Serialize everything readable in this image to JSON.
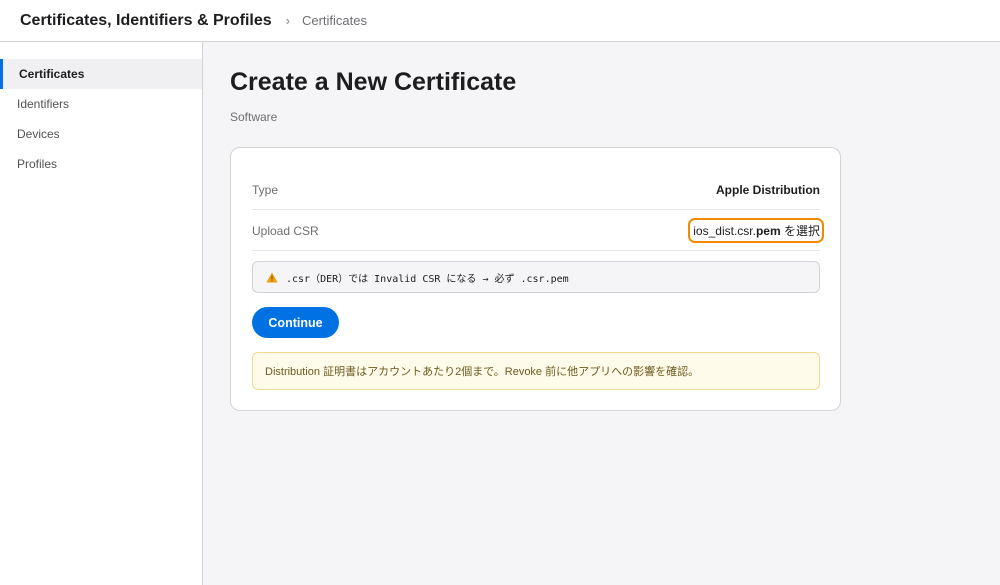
{
  "header": {
    "app_title": "Certificates, Identifiers & Profiles",
    "separator": "›",
    "breadcrumb": "Certificates"
  },
  "sidebar": {
    "items": [
      {
        "label": "Certificates",
        "active": true
      },
      {
        "label": "Identifiers"
      },
      {
        "label": "Devices"
      },
      {
        "label": "Profiles"
      }
    ]
  },
  "main": {
    "title": "Create a New Certificate",
    "subtitle": "Software",
    "form": {
      "type_label": "Type",
      "type_value": "Apple Distribution",
      "csr_label": "Upload CSR",
      "csr_file_prefix": "ios_dist.csr.",
      "csr_file_ext": "pem",
      "csr_file_suffix": " を選択",
      "warning_icon": "warning-triangle-icon",
      "warning_text": ".csr（DER）では Invalid CSR になる → 必ず .csr.pem",
      "continue_label": "Continue",
      "note_text": "Distribution 証明書はアカウントあたり2個まで。Revoke 前に他アプリへの影響を確認。"
    }
  },
  "colors": {
    "accent": "#0071e3",
    "highlight_outline": "#f08a00",
    "warning_icon": "#f0a000",
    "note_bg": "#fffbea",
    "note_border": "#f0d98c"
  }
}
